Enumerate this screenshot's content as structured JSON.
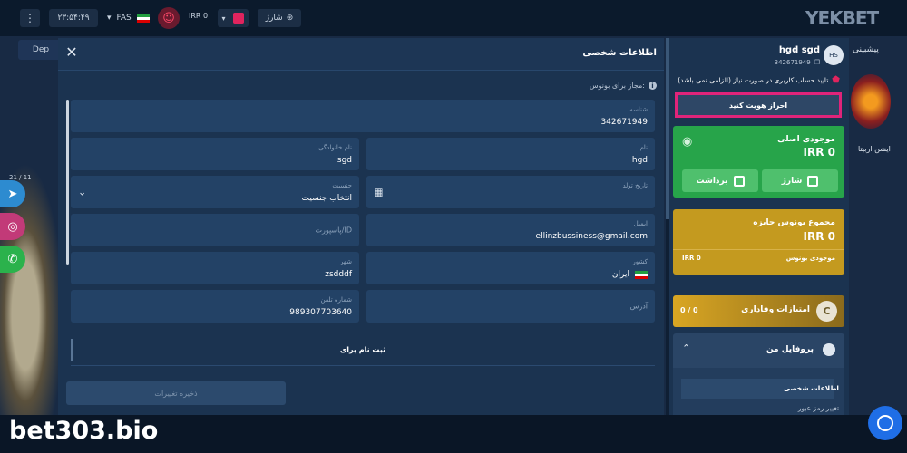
{
  "topbar": {
    "menu_icon": "⋮",
    "clock": "۲۳:۵۴:۴۹",
    "lang": "FAS",
    "balance": "IRR 0",
    "charge": "شارژ",
    "logo": "YEKBET"
  },
  "background": {
    "deposit_label": "Dep",
    "right_title": "پیشبینی",
    "right_game_label": "ایشن اربیتا",
    "left_date": "21 / 11"
  },
  "modal": {
    "title": "اطلاعات شخصی",
    "bonus_note": "مجاز برای بونوس:",
    "fields": {
      "shenase_label": "شناسه",
      "shenase_value": "342671949",
      "family_label": "نام خانوادگی",
      "family_value": "sgd",
      "name_label": "نام",
      "name_value": "hgd",
      "gender_label": "جنسیت",
      "gender_value": "انتخاب جنسیت",
      "birth_label": "تاریخ تولد",
      "passport_placeholder": "پاسپورت/ID",
      "email_label": "ایمیل",
      "email_value": "ellinzbussiness@gmail.com",
      "city_label": "شهر",
      "city_value": "zsdddf",
      "country_label": "کشور",
      "country_value": "ایران",
      "phone_label": "شماره تلفن",
      "phone_value": "989307703640",
      "address_placeholder": "آدرس"
    },
    "register_text": "ثبت نام برای",
    "save_button": "ذخیره تغییرات"
  },
  "profile": {
    "name": "hgd sgd",
    "id": "342671949",
    "avatar_initials": "HS",
    "verify_note": "تایید حساب کاربری در صورت نیاز (الزامی نمی باشد)",
    "kyc_button": "احراز هویت کنید",
    "main_balance_title": "موجودی اصلی",
    "main_balance_value": "IRR 0",
    "charge_button": "شارژ",
    "withdraw_button": "برداشت",
    "bonus_title": "مجموع بونوس جایزه",
    "bonus_value": "IRR 0",
    "bonus_row_label": "موجودی بونوس",
    "bonus_row_value": "IRR 0",
    "loyalty_title": "امتیازات وفاداری",
    "loyalty_value": "0 / 0",
    "loyalty_icon_letter": "C",
    "my_profile": "پروفایل من",
    "submenu": [
      "اطلاعات شخصی",
      "تغییر رمز عبور"
    ]
  },
  "watermark": "bet303.bio",
  "colors": {
    "accent_pink": "#e0247a",
    "green_card": "#27a44a",
    "gold_card": "#c49a1f",
    "chat_blue": "#1f6ee6"
  }
}
